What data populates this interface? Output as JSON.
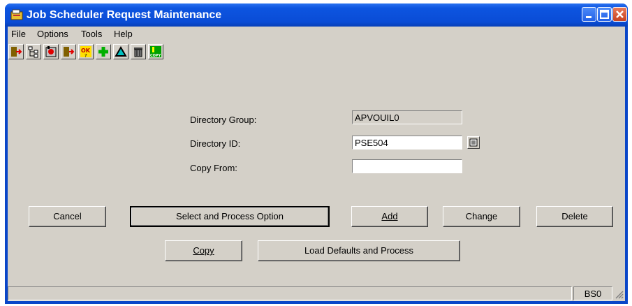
{
  "window": {
    "title": "Job Scheduler Request Maintenance"
  },
  "menu": [
    {
      "label": "File"
    },
    {
      "label": "Options"
    },
    {
      "label": "Tools"
    },
    {
      "label": "Help"
    }
  ],
  "toolbar": {
    "ok_label": "OK",
    "copy_label": "COPY"
  },
  "form": {
    "directory_group_label": "Directory Group:",
    "directory_group_value": "APVOUIL0",
    "directory_id_label": "Directory ID:",
    "directory_id_value": "PSE504",
    "copy_from_label": "Copy From:",
    "copy_from_value": ""
  },
  "buttons": {
    "cancel": "Cancel",
    "select_process": "Select and Process Option",
    "add": "Add",
    "change": "Change",
    "delete": "Delete",
    "copy": "Copy",
    "load_defaults": "Load Defaults and Process"
  },
  "status": {
    "code": "BS0"
  },
  "colors": {
    "title_bar": "#0a4cd6",
    "face": "#d4d0c8",
    "plus": "#00c000"
  }
}
